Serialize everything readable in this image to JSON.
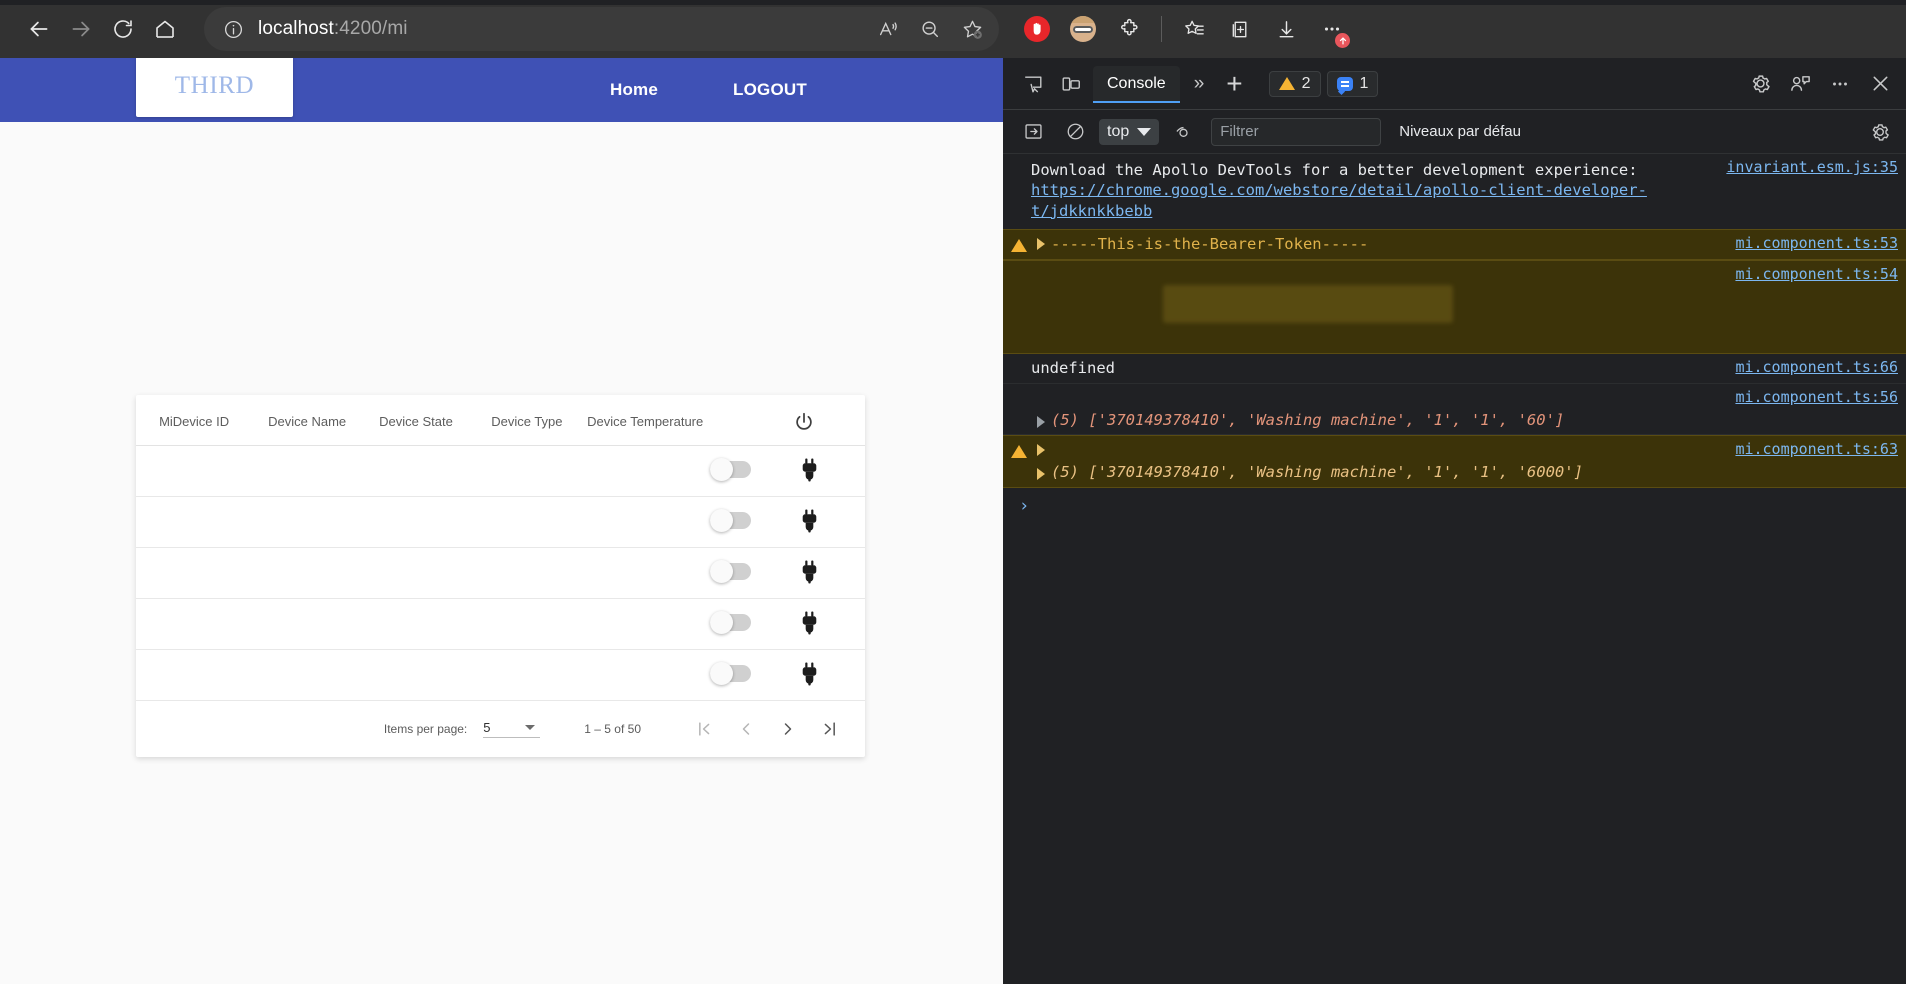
{
  "browser": {
    "url_host": "localhost",
    "url_path": ":4200/mi",
    "back_icon": "back-arrow-icon",
    "forward_icon": "forward-arrow-icon",
    "reload_icon": "reload-icon",
    "home_icon": "home-icon",
    "info_icon": "site-info-icon",
    "read_aloud_icon": "read-aloud-icon",
    "zoom_icon": "zoom-out-icon",
    "favorite_icon": "add-favorite-icon",
    "split_screen_icon": "split-screen-icon",
    "collections_icon": "collections-icon",
    "downloads_icon": "downloads-icon",
    "settings_more_icon": "more-options-icon"
  },
  "app": {
    "brand": "THIRD",
    "nav": [
      {
        "label": "Home",
        "name": "nav-link-home"
      },
      {
        "label": "LOGOUT",
        "name": "nav-link-logout"
      }
    ],
    "table": {
      "headers": [
        "MiDevice ID",
        "Device Name",
        "Device State",
        "Device Type",
        "Device Temperature"
      ],
      "power_icon": "power-icon",
      "rows": [
        {
          "id": "",
          "name": "",
          "state": "",
          "type": "",
          "temperature": "",
          "toggle": false,
          "plug_icon": "plug-icon"
        },
        {
          "id": "",
          "name": "",
          "state": "",
          "type": "",
          "temperature": "",
          "toggle": false,
          "plug_icon": "plug-icon"
        },
        {
          "id": "",
          "name": "",
          "state": "",
          "type": "",
          "temperature": "",
          "toggle": false,
          "plug_icon": "plug-icon"
        },
        {
          "id": "",
          "name": "",
          "state": "",
          "type": "",
          "temperature": "",
          "toggle": false,
          "plug_icon": "plug-icon"
        },
        {
          "id": "",
          "name": "",
          "state": "",
          "type": "",
          "temperature": "",
          "toggle": false,
          "plug_icon": "plug-icon"
        }
      ]
    },
    "paginator": {
      "items_per_page_label": "Items per page:",
      "items_per_page_value": "5",
      "range_label": "1 – 5 of 50",
      "first_page_icon": "first-page-icon",
      "prev_page_icon": "previous-page-icon",
      "next_page_icon": "next-page-icon",
      "last_page_icon": "last-page-icon"
    }
  },
  "devtools": {
    "inspect_icon": "inspect-element-icon",
    "device_toolbar_icon": "device-toolbar-icon",
    "active_tab": "Console",
    "more_tabs_icon": "more-tabs-icon",
    "new_tab_icon": "add-tab-icon",
    "warning_count": "2",
    "info_count": "1",
    "settings_icon": "settings-gear-icon",
    "customize_icon": "customize-devtools-icon",
    "more_icon": "more-options-icon",
    "close_icon": "close-devtools-icon",
    "sidebar_icon": "show-console-sidebar-icon",
    "clear_icon": "clear-console-icon",
    "context": "top",
    "eye_icon": "live-expression-icon",
    "filter_placeholder": "Filtrer",
    "levels_label": "Niveaux par défau",
    "prompt_icon": "console-prompt-chevron",
    "messages": [
      {
        "type": "info",
        "text_before": "Download the Apollo DevTools for a better development experience: ",
        "link": "https://chrome.google.com/webstore/detail/apollo-client-developer-t/jdkknkkbebb",
        "source": "invariant.esm.js:35"
      },
      {
        "type": "warning",
        "text": "-----This-is-the-Bearer-Token-----",
        "source": "mi.component.ts:53"
      },
      {
        "type": "warning-redacted",
        "text": "",
        "source": "mi.component.ts:54"
      },
      {
        "type": "log",
        "text": "undefined",
        "source": "mi.component.ts:66"
      },
      {
        "type": "array",
        "text": "(5) ['370149378410', 'Washing machine', '1', '1', '60']",
        "source": "mi.component.ts:56"
      },
      {
        "type": "warning-array",
        "text": "(5) ['370149378410', 'Washing machine', '1', '1', '6000']",
        "source": "mi.component.ts:63"
      }
    ]
  },
  "colors": {
    "app_primary": "#3f51b5",
    "devtools_bg": "#202124",
    "warning": "#f5b333",
    "link": "#7cb7f0"
  }
}
